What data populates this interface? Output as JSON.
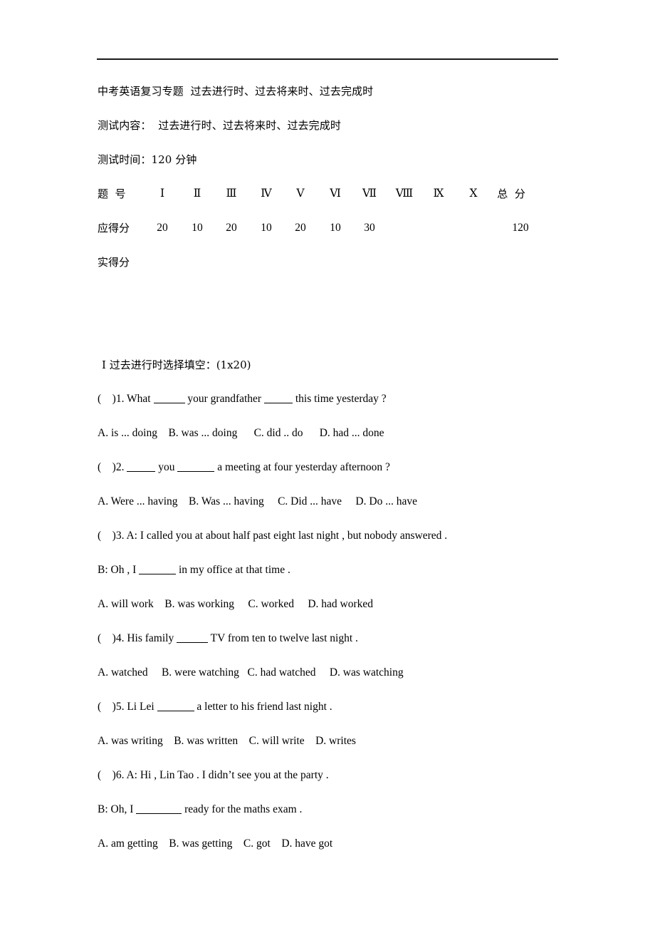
{
  "document": {
    "title_line": "中考英语复习专题  过去进行时、过去将来时、过去完成时",
    "test_content_line": "测试内容：  过去进行时、过去将来时、过去完成时",
    "test_time_line": "测试时间：120 分钟"
  },
  "score_table": {
    "header_label": "题  号",
    "expected_label": "应得分",
    "actual_label": "实得分",
    "total_label": "总  分",
    "columns": [
      "Ⅰ",
      "Ⅱ",
      "Ⅲ",
      "Ⅳ",
      "Ⅴ",
      "Ⅵ",
      "Ⅶ",
      "Ⅷ",
      "Ⅸ",
      "Ⅹ"
    ],
    "expected_points": [
      "20",
      "10",
      "20",
      "10",
      "20",
      "10",
      "30",
      "",
      "",
      ""
    ],
    "expected_total": "120",
    "actual_points": [
      "",
      "",
      "",
      "",
      "",
      "",
      "",
      "",
      "",
      ""
    ],
    "actual_total": ""
  },
  "section": {
    "heading": "Ⅰ 过去进行时选择填空：(1x20)"
  },
  "questions": [
    {
      "bracket": "(    )",
      "number": "1.",
      "stem_part1": " What ",
      "stem_part2": " your grandfather ",
      "stem_part3": " this time yesterday ?",
      "options_line": "A. is ... doing    B. was ... doing      C. did .. do      D. had ... done"
    },
    {
      "bracket": "(    )",
      "number": "2.",
      "stem_part1": " ",
      "stem_part2": " you ",
      "stem_part3": " a meeting at four yesterday afternoon ?",
      "options_line": "A. Were ... having    B. Was ... having     C. Did ... have     D. Do ... have"
    },
    {
      "bracket": "(    )",
      "number": "3.",
      "dialogue_a": " A: I called you at about half past eight last night , but nobody answered .",
      "dialogue_b_part1": "B: Oh , I ",
      "dialogue_b_part2": " in my office at that time .",
      "options_line": "A. will work    B. was working     C. worked     D. had worked"
    },
    {
      "bracket": "(    )",
      "number": "4.",
      "stem_part1": " His family ",
      "stem_part2": " TV from ten to twelve last night .",
      "options_line": "A. watched     B. were watching   C. had watched     D. was watching"
    },
    {
      "bracket": "(    )",
      "number": "5.",
      "stem_part1": " Li Lei ",
      "stem_part2": " a letter to his friend last night .",
      "options_line": "A. was writing    B. was written    C. will write    D. writes"
    },
    {
      "bracket": "(    )",
      "number": "6.",
      "dialogue_a": " A: Hi , Lin Tao . I didn’t see you at the party .",
      "dialogue_b_part1": "B: Oh, I ",
      "dialogue_b_part2": " ready for the maths exam .",
      "options_line": "A. am getting    B. was getting    C. got    D. have got"
    }
  ]
}
